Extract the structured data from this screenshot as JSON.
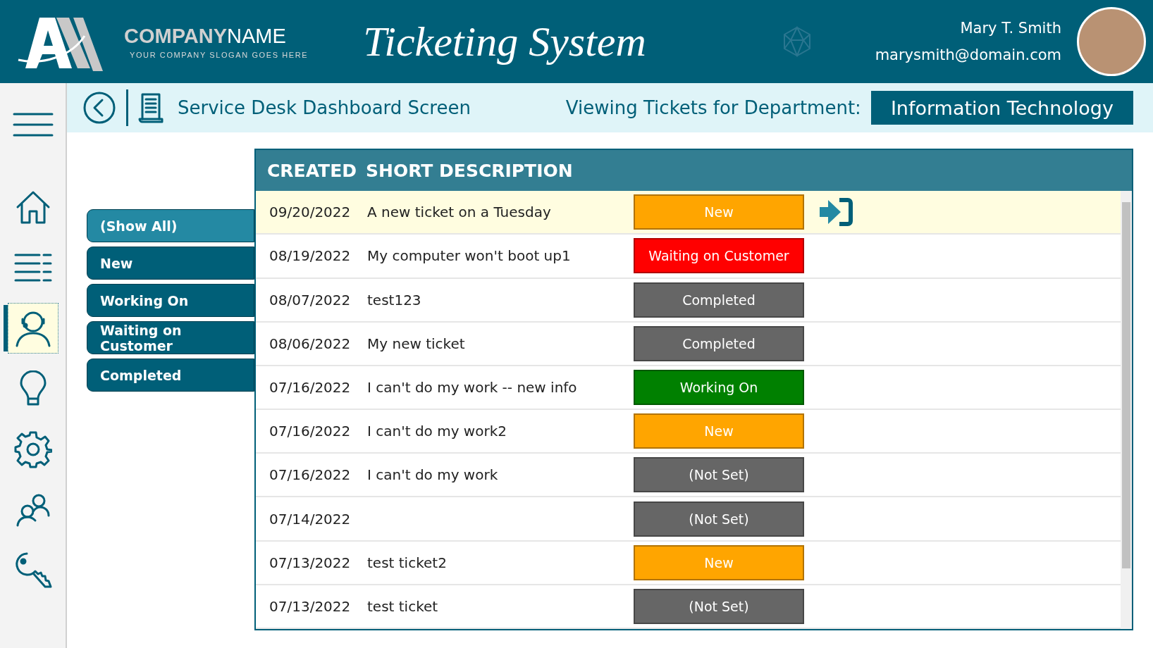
{
  "header": {
    "logo_company_bold": "COMPANY",
    "logo_company_light": "NAME",
    "logo_slogan": "YOUR COMPANY SLOGAN GOES HERE",
    "app_title": "Ticketing System",
    "user_name": "Mary T. Smith",
    "user_email": "marysmith@domain.com"
  },
  "toolbar": {
    "screen_title": "Service Desk Dashboard Screen",
    "department_label": "Viewing Tickets for Department:",
    "department": "Information Technology"
  },
  "nav": [
    {
      "kind": "menu",
      "selected": false
    },
    {
      "kind": "home",
      "selected": false
    },
    {
      "kind": "list",
      "selected": false
    },
    {
      "kind": "agent",
      "selected": true
    },
    {
      "kind": "bulb",
      "selected": false
    },
    {
      "kind": "gear",
      "selected": false
    },
    {
      "kind": "people",
      "selected": false
    },
    {
      "kind": "key",
      "selected": false
    }
  ],
  "filters": [
    {
      "label": "(Show All)",
      "selected": true
    },
    {
      "label": "New",
      "selected": false
    },
    {
      "label": "Working On",
      "selected": false
    },
    {
      "label": "Waiting on Customer",
      "selected": false
    },
    {
      "label": "Completed",
      "selected": false
    }
  ],
  "table": {
    "columns": [
      "CREATED",
      "SHORT DESCRIPTION"
    ],
    "rows": [
      {
        "created": "09/20/2022",
        "description": "A new ticket on a Tuesday",
        "status": "New",
        "color": "#ffa500",
        "selected": true
      },
      {
        "created": "08/19/2022",
        "description": "My computer won't boot up1",
        "status": "Waiting on Customer",
        "color": "#ff0000",
        "selected": false
      },
      {
        "created": "08/07/2022",
        "description": "test123",
        "status": "Completed",
        "color": "#666666",
        "selected": false
      },
      {
        "created": "08/06/2022",
        "description": "My new ticket",
        "status": "Completed",
        "color": "#666666",
        "selected": false
      },
      {
        "created": "07/16/2022",
        "description": "I can't do my work -- new info",
        "status": "Working On",
        "color": "#008000",
        "selected": false
      },
      {
        "created": "07/16/2022",
        "description": "I can't do my work2",
        "status": "New",
        "color": "#ffa500",
        "selected": false
      },
      {
        "created": "07/16/2022",
        "description": "I can't do my work",
        "status": "(Not Set)",
        "color": "#666666",
        "selected": false
      },
      {
        "created": "07/14/2022",
        "description": "",
        "status": "(Not Set)",
        "color": "#666666",
        "selected": false
      },
      {
        "created": "07/13/2022",
        "description": "test ticket2",
        "status": "New",
        "color": "#ffa500",
        "selected": false
      },
      {
        "created": "07/13/2022",
        "description": "test ticket",
        "status": "(Not Set)",
        "color": "#666666",
        "selected": false
      }
    ]
  }
}
